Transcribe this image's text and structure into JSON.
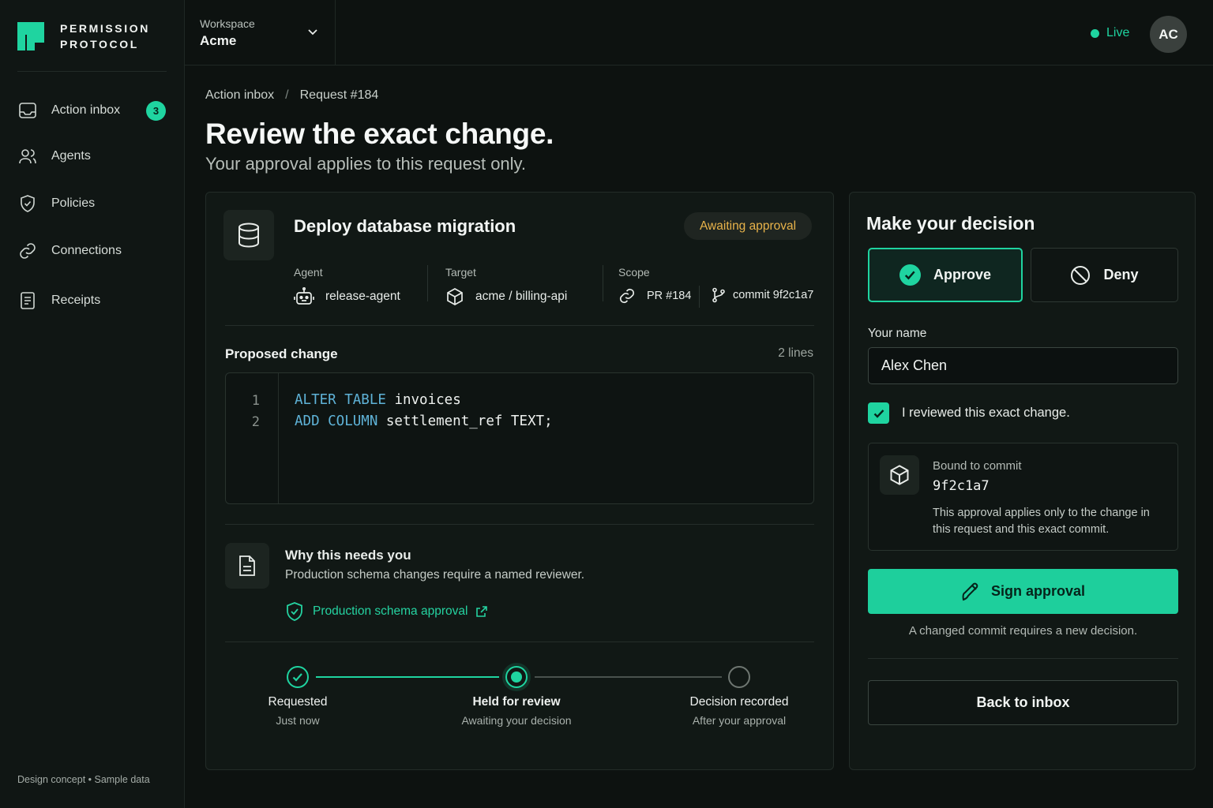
{
  "brand": {
    "line1": "PERMISSION",
    "line2": "PROTOCOL",
    "accent": "#1fd4a0"
  },
  "sidebar": {
    "items": [
      {
        "label": "Action inbox",
        "icon": "inbox-icon",
        "badge": "3"
      },
      {
        "label": "Agents",
        "icon": "users-icon"
      },
      {
        "label": "Policies",
        "icon": "shield-icon"
      },
      {
        "label": "Connections",
        "icon": "link-icon"
      },
      {
        "label": "Receipts",
        "icon": "receipt-icon"
      }
    ],
    "footer": "Design concept • Sample data"
  },
  "topbar": {
    "workspace_label": "Workspace",
    "workspace_value": "Acme",
    "status": "Live",
    "avatar_initials": "AC"
  },
  "breadcrumb": {
    "parent": "Action inbox",
    "separator": "/",
    "current": "Request #184"
  },
  "page": {
    "title": "Review the exact change.",
    "subtitle": "Your approval applies to this request only."
  },
  "request": {
    "title": "Deploy database migration",
    "status": "Awaiting approval",
    "status_color": "#e8b34a",
    "agent_label": "Agent",
    "agent_value": "release-agent",
    "target_label": "Target",
    "target_value": "acme / billing-api",
    "scope_label": "Scope",
    "scope_pr": "PR #184",
    "scope_commit": "commit 9f2c1a7",
    "proposed_label": "Proposed change",
    "lines_count": "2 lines",
    "code": [
      {
        "no": "1",
        "keyword": "ALTER TABLE",
        "rest": " invoices"
      },
      {
        "no": "2",
        "keyword": "ADD COLUMN",
        "rest": " settlement_ref TEXT;"
      }
    ],
    "why_title": "Why this needs you",
    "why_text": "Production schema changes require a named reviewer.",
    "policy_link": "Production schema approval"
  },
  "steps": [
    {
      "label": "Requested",
      "sub": "Just now",
      "state": "done"
    },
    {
      "label": "Held for review",
      "sub": "Awaiting your decision",
      "state": "current"
    },
    {
      "label": "Decision recorded",
      "sub": "After your approval",
      "state": "pending"
    }
  ],
  "decision": {
    "title": "Make your decision",
    "approve_label": "Approve",
    "deny_label": "Deny",
    "name_label": "Your name",
    "name_value": "Alex Chen",
    "checkbox_label": "I reviewed this exact change.",
    "checkbox_checked": true,
    "bound_label": "Bound to commit",
    "bound_commit": "9f2c1a7",
    "bound_note": "This approval applies only to the change in this request and this exact commit.",
    "sign_label": "Sign approval",
    "sign_note": "A changed commit requires a new decision.",
    "back_label": "Back to inbox"
  }
}
